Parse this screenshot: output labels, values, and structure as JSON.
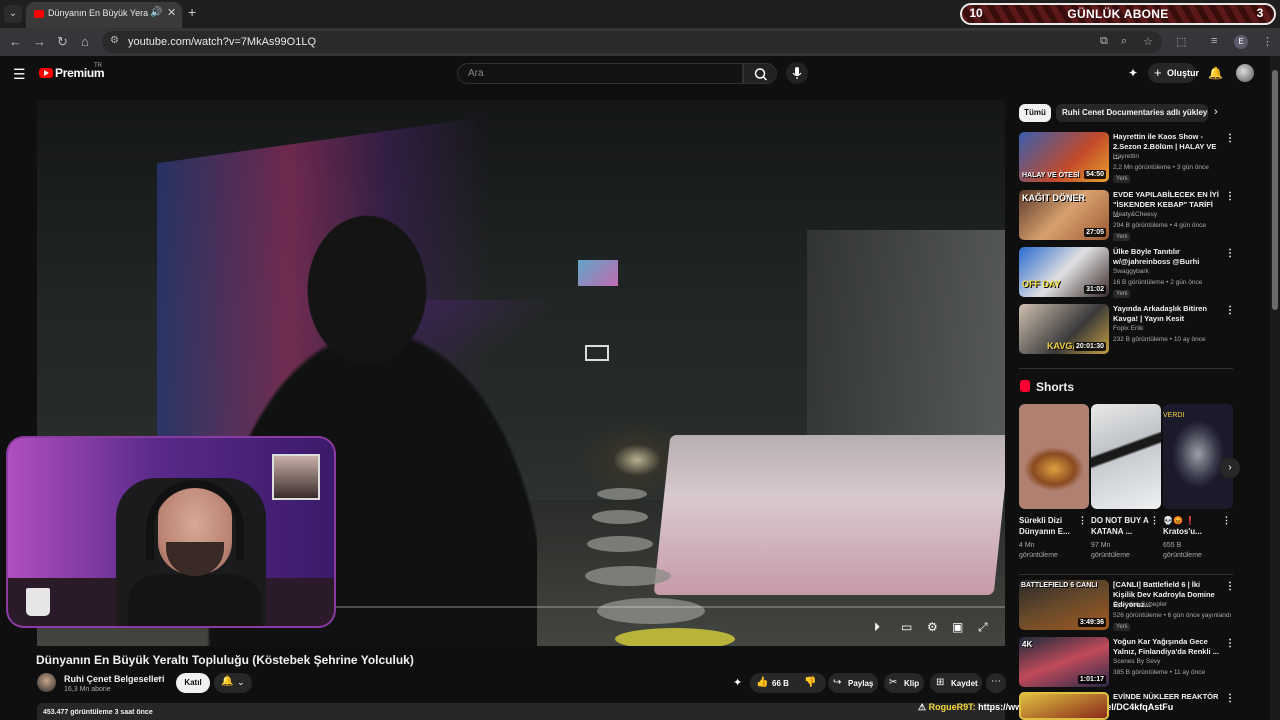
{
  "browser": {
    "tab_title": "Dünyanın En Büyük Yeraltı T",
    "url": "youtube.com/watch?v=7MkAs99O1LQ",
    "profile_letter": "E"
  },
  "overlay_banner": {
    "left_count": "10",
    "label": "GÜNLÜK ABONE",
    "right_count": "3"
  },
  "youtube_header": {
    "logo_text": "Premium",
    "country_code": "TR",
    "search_placeholder": "Ara",
    "create_label": "Oluştur"
  },
  "video": {
    "title": "Dünyanın En Büyük Yeraltı Topluluğu (Köstebek Şehrine Yolculuk)",
    "channel": "Ruhi Çenet Belgeselleri",
    "subscribers": "16,3 Mn abone",
    "join_label": "Katıl",
    "likes": "66 B",
    "share_label": "Paylaş",
    "clip_label": "Klip",
    "save_label": "Kaydet",
    "views_line": "453.477 görüntüleme  3 saat önce"
  },
  "chat_overlay": {
    "user": "RogueR9T:",
    "message": "https://www.instagram.com/reel/DC4kfqAstFu"
  },
  "sidebar": {
    "chips": [
      "Tümü",
      "Ruhi Cenet Documentaries adlı yükleyiciden"
    ],
    "recommendations": [
      {
        "title": "Hayrettin ile Kaos Show - 2.Sezon 2.Bölüm | HALAY VE ...",
        "channel": "Hayrettin",
        "meta": "2,2 Mn görüntüleme • 3 gün önce",
        "badge": "Yeni",
        "duration": "54:50",
        "thumb_text": "HALAY VE ÖTESİ"
      },
      {
        "title": "EVDE YAPILABİLECEK EN İYİ \"İSKENDER KEBAP\" TARİFİ ...",
        "channel": "Meaty&Cheesy",
        "meta": "294 B görüntüleme • 4 gün önce",
        "badge": "Yeni",
        "duration": "27:05",
        "thumb_text": "KAĞIT DÖNER"
      },
      {
        "title": "Ülke Böyle Tanıtılır w/@jahreinboss @Burhi",
        "channel": "Swaggybark",
        "meta": "16 B görüntüleme • 2 gün önce",
        "badge": "Yeni",
        "duration": "31:02",
        "thumb_text": "OFF DAY"
      },
      {
        "title": "Yayında Arkadaşlık Bitiren Kavga! | Yayın Kesit",
        "channel": "Fopix Erlik",
        "meta": "232 B görüntüleme • 10 ay önce",
        "badge": "",
        "duration": "20:01:30",
        "thumb_text": "KAVGA"
      }
    ],
    "shorts_heading": "Shorts",
    "shorts": [
      {
        "title": "Sürekli Dizi Dünyanın E...",
        "views": "4 Mn",
        "views_label": "görüntüleme"
      },
      {
        "title": "DO NOT BUY A KATANA ...",
        "views": "97 Mn",
        "views_label": "görüntüleme"
      },
      {
        "title": "💀😡 ❗ Kratos'u...",
        "views": "655 B",
        "views_label": "görüntüleme",
        "thumb_text": "VERDI"
      }
    ],
    "more_recommendations": [
      {
        "title": "[CANLI] Battlefield 6 | İki Kişilik Dev Kadroyla Domine Ediyoruz...",
        "channel": "Oyundan Sebepler",
        "meta": "526 görüntüleme • 6 gün önce yayınlandı",
        "badge": "Yeni",
        "duration": "3:49:36",
        "thumb_text": "BATTLEFIELD 6  CANLI"
      },
      {
        "title": "Yoğun Kar Yağışında Gece Yalnız, Finlandiya'da Renkli ...",
        "channel": "Scenes By Sevy",
        "meta": "385 B görüntüleme • 11 ay önce",
        "badge": "",
        "duration": "1:01:17",
        "thumb_text": "4K"
      },
      {
        "title": "EVİNDE NÜKLEER REAKTÖR",
        "channel": "",
        "meta": "",
        "badge": "",
        "duration": "",
        "thumb_text": ""
      }
    ]
  },
  "colors": {
    "background": "#0f0f0f",
    "youtube_red": "#ff0000",
    "chat_user": "#f4d83a"
  }
}
